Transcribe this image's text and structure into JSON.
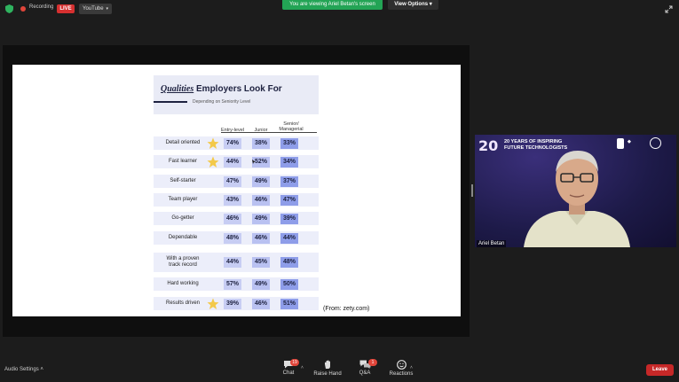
{
  "topbar": {
    "recording_label": "Recording",
    "live_label": "LIVE",
    "stream_target": "YouTube",
    "viewing_banner": "You are viewing Ariel Betan's screen",
    "view_options": "View Options"
  },
  "slide": {
    "title_italic": "Qualities",
    "title_rest": " Employers Look For",
    "subtitle": "Depending on Seniority Level",
    "columns": [
      "Entry-level",
      "Junior",
      "Senior/\nManagerial"
    ],
    "rows": [
      {
        "label": "Detail oriented",
        "star": true,
        "values": [
          "74%",
          "38%",
          "33%"
        ]
      },
      {
        "label": "Fast learner",
        "star": true,
        "values": [
          "44%",
          "52%",
          "34%"
        ]
      },
      {
        "label": "Self-starter",
        "star": false,
        "values": [
          "47%",
          "49%",
          "37%"
        ]
      },
      {
        "label": "Team player",
        "star": false,
        "values": [
          "43%",
          "46%",
          "47%"
        ]
      },
      {
        "label": "Go-getter",
        "star": false,
        "values": [
          "46%",
          "49%",
          "39%"
        ]
      },
      {
        "label": "Dependable",
        "star": false,
        "values": [
          "48%",
          "46%",
          "44%"
        ]
      },
      {
        "label": "With a proven\ntrack record",
        "star": false,
        "values": [
          "44%",
          "45%",
          "48%"
        ]
      },
      {
        "label": "Hard working",
        "star": false,
        "values": [
          "57%",
          "49%",
          "50%"
        ]
      },
      {
        "label": "Results driven",
        "star": true,
        "values": [
          "39%",
          "46%",
          "51%"
        ]
      }
    ],
    "source": "(From: zety.com)"
  },
  "video": {
    "banner_number": "20",
    "banner_line1": "20 YEARS OF INSPIRING",
    "banner_line2": "FUTURE TECHNOLOGISTS",
    "speaker_name": "Ariel Betan"
  },
  "toolbar": {
    "audio_settings": "Audio Settings",
    "chat_label": "Chat",
    "chat_badge": "19",
    "raise_hand_label": "Raise Hand",
    "qa_label": "Q&A",
    "qa_badge": "1",
    "reactions_label": "Reactions",
    "leave_label": "Leave"
  },
  "colors": {
    "viewing_banner": "#23a455",
    "live_badge": "#d63030",
    "leave_button": "#c62828",
    "cell_entry": "#c7cdf3",
    "cell_junior": "#b9c1f1",
    "cell_senior": "#8e9de9"
  }
}
